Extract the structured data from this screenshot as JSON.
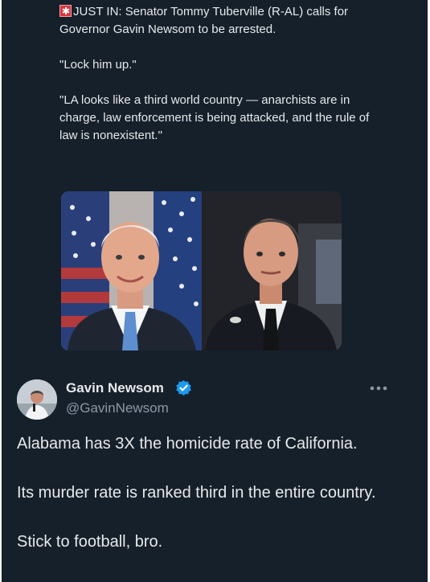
{
  "quoted_post": {
    "alert_icon": "rotating-light-icon",
    "headline": "JUST IN: Senator Tommy Tuberville (R-AL) calls for Governor Gavin Newsom to be arrested.",
    "quote_1": "\"Lock him up.\"",
    "quote_2": "\"LA looks like a third world country — anarchists are in charge, law enforcement is being attacked, and the rule of law is nonexistent.\"",
    "photos": [
      {
        "subject": "photo-left-portrait"
      },
      {
        "subject": "photo-right-portrait"
      }
    ]
  },
  "reply_post": {
    "author_name": "Gavin Newsom",
    "handle": "@GavinNewsom",
    "verified_icon": "verified-badge-icon",
    "more_icon": "more-options-icon",
    "paragraphs": [
      "Alabama has 3X the homicide rate of California.",
      "Its murder rate is ranked third in the entire country.",
      "Stick to football, bro."
    ]
  },
  "colors": {
    "background": "#15202b",
    "text": "#e7e9ea",
    "secondary_text": "#8b98a5",
    "verified": "#1d9bf0",
    "alert": "#d93641"
  }
}
